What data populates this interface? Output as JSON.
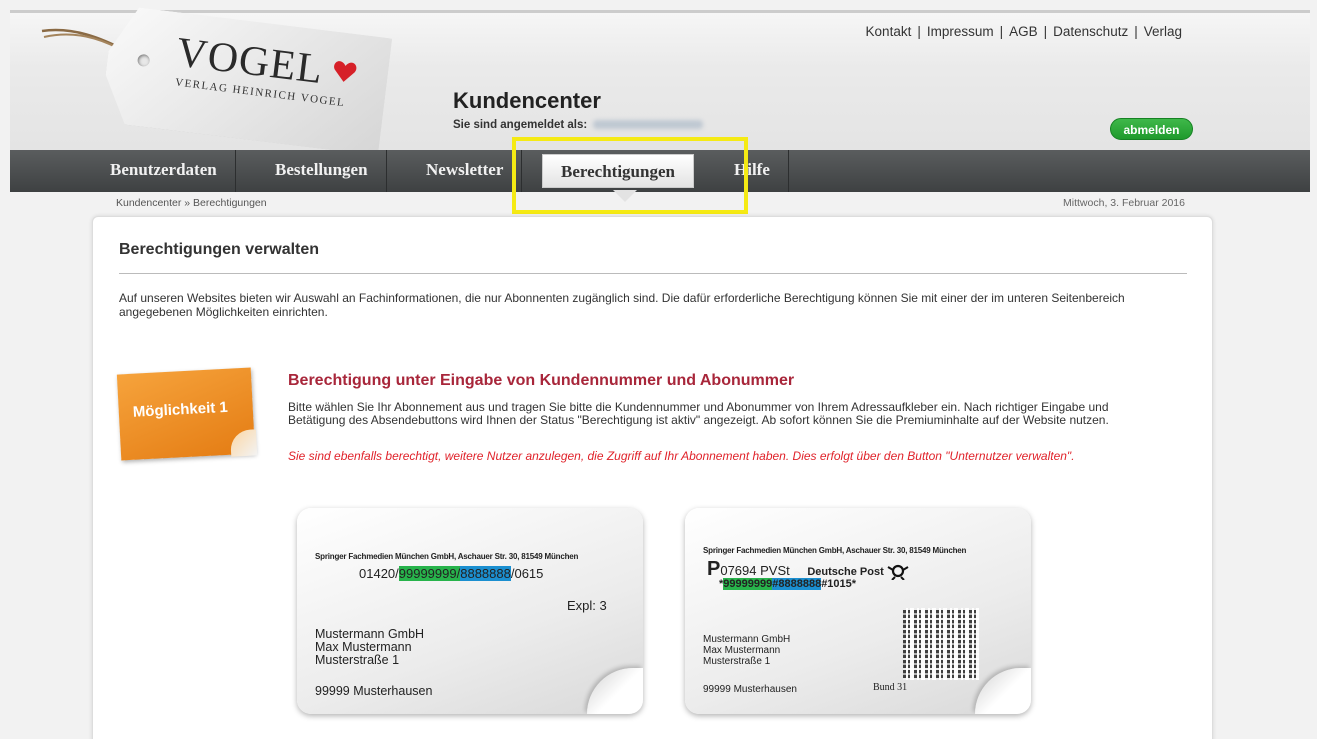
{
  "toplinks": [
    "Kontakt",
    "Impressum",
    "AGB",
    "Datenschutz",
    "Verlag"
  ],
  "logo": {
    "brand": "VOGEL",
    "subline": "VERLAG HEINRICH VOGEL",
    "heart_color": "#d62028"
  },
  "header": {
    "title": "Kundencenter",
    "user_label": "Sie sind angemeldet als:",
    "logout_label": "abmelden"
  },
  "nav": {
    "items": [
      "Benutzerdaten",
      "Bestellungen",
      "Newsletter",
      "Berechtigungen",
      "Hilfe"
    ],
    "active": "Berechtigungen"
  },
  "breadcrumb": "Kundencenter » Berechtigungen",
  "date": "Mittwoch, 3. Februar 2016",
  "page": {
    "title": "Berechtigungen verwalten",
    "intro": "Auf unseren Websites bieten wir Auswahl an Fachinformationen, die nur Abonnenten zugänglich sind. Die dafür erforderliche Berechtigung können Sie mit einer der im unteren Seitenbereich angegebenen Möglichkeiten einrichten."
  },
  "option1": {
    "badge": "Möglichkeit 1",
    "title": "Berechtigung unter Eingabe von Kundennummer und Abonummer",
    "text": "Bitte wählen Sie Ihr Abonnement aus und tragen Sie bitte die Kundennummer und Abonummer von Ihrem Adressaufkleber ein. Nach richtiger Eingabe und Betätigung des Absendebuttons wird Ihnen der Status \"Berechtigung ist aktiv\" angezeigt. Ab sofort können Sie die Premiuminhalte auf der Website nutzen.",
    "note": "Sie sind ebenfalls berechtigt, weitere Nutzer anzulegen, die Zugriff auf Ihr Abonnement haben. Dies erfolgt über den Button \"Unternutzer verwalten\"."
  },
  "card1": {
    "sender": "Springer Fachmedien München GmbH, Aschauer Str. 30, 81549 München",
    "code_prefix": "01420/",
    "kundennummer": "99999999",
    "slash": "/",
    "abonummer": "8888888",
    "code_suffix": "/0615",
    "expl": "Expl: 3",
    "addr1": "Mustermann GmbH",
    "addr2": "Max Mustermann",
    "addr3": "Musterstraße 1",
    "city": "99999 Musterhausen"
  },
  "card2": {
    "sender": "Springer Fachmedien München GmbH, Aschauer Str. 30, 81549 München",
    "pvst_p": "P",
    "pvst": "07694  PVSt",
    "post": "Deutsche Post",
    "code_prefix": "*",
    "kundennummer": "99999999",
    "hash": "#",
    "abonummer": "8888888",
    "code_suffix": "#1015*",
    "addr1": "Mustermann GmbH",
    "addr2": "Max Mustermann",
    "addr3": "Musterstraße 1",
    "city": "99999 Musterhausen",
    "bund": "Bund  31"
  },
  "colors": {
    "nav_bg": "#4b4e4f",
    "accent_red": "#a8263a",
    "note_red": "#e0222a",
    "badge_orange": "#ee8e25",
    "logout_green": "#2aa83a",
    "kundennummer_green": "#27b34b",
    "abonummer_blue": "#1b8fd0",
    "highlight_yellow": "#f5ea14"
  }
}
